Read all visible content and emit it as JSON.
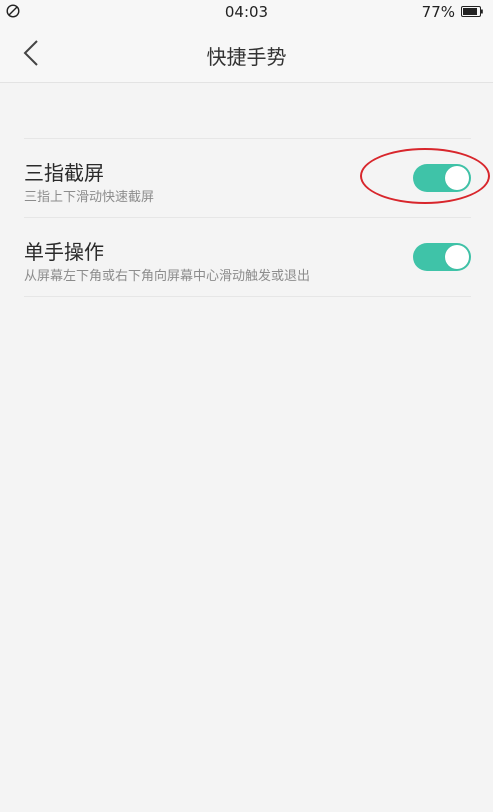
{
  "status_bar": {
    "time": "04:03",
    "battery_percent": "77%",
    "left_icon": "do-not-disturb-icon",
    "battery_icon": "battery-icon"
  },
  "header": {
    "title": "快捷手势",
    "back_icon": "chevron-left-icon"
  },
  "settings": [
    {
      "title": "三指截屏",
      "description": "三指上下滑动快速截屏",
      "enabled": true
    },
    {
      "title": "单手操作",
      "description": "从屏幕左下角或右下角向屏幕中心滑动触发或退出",
      "enabled": true
    }
  ],
  "colors": {
    "toggle_on": "#3fc3a8",
    "annotation": "#d8262c",
    "background": "#f4f4f4"
  }
}
